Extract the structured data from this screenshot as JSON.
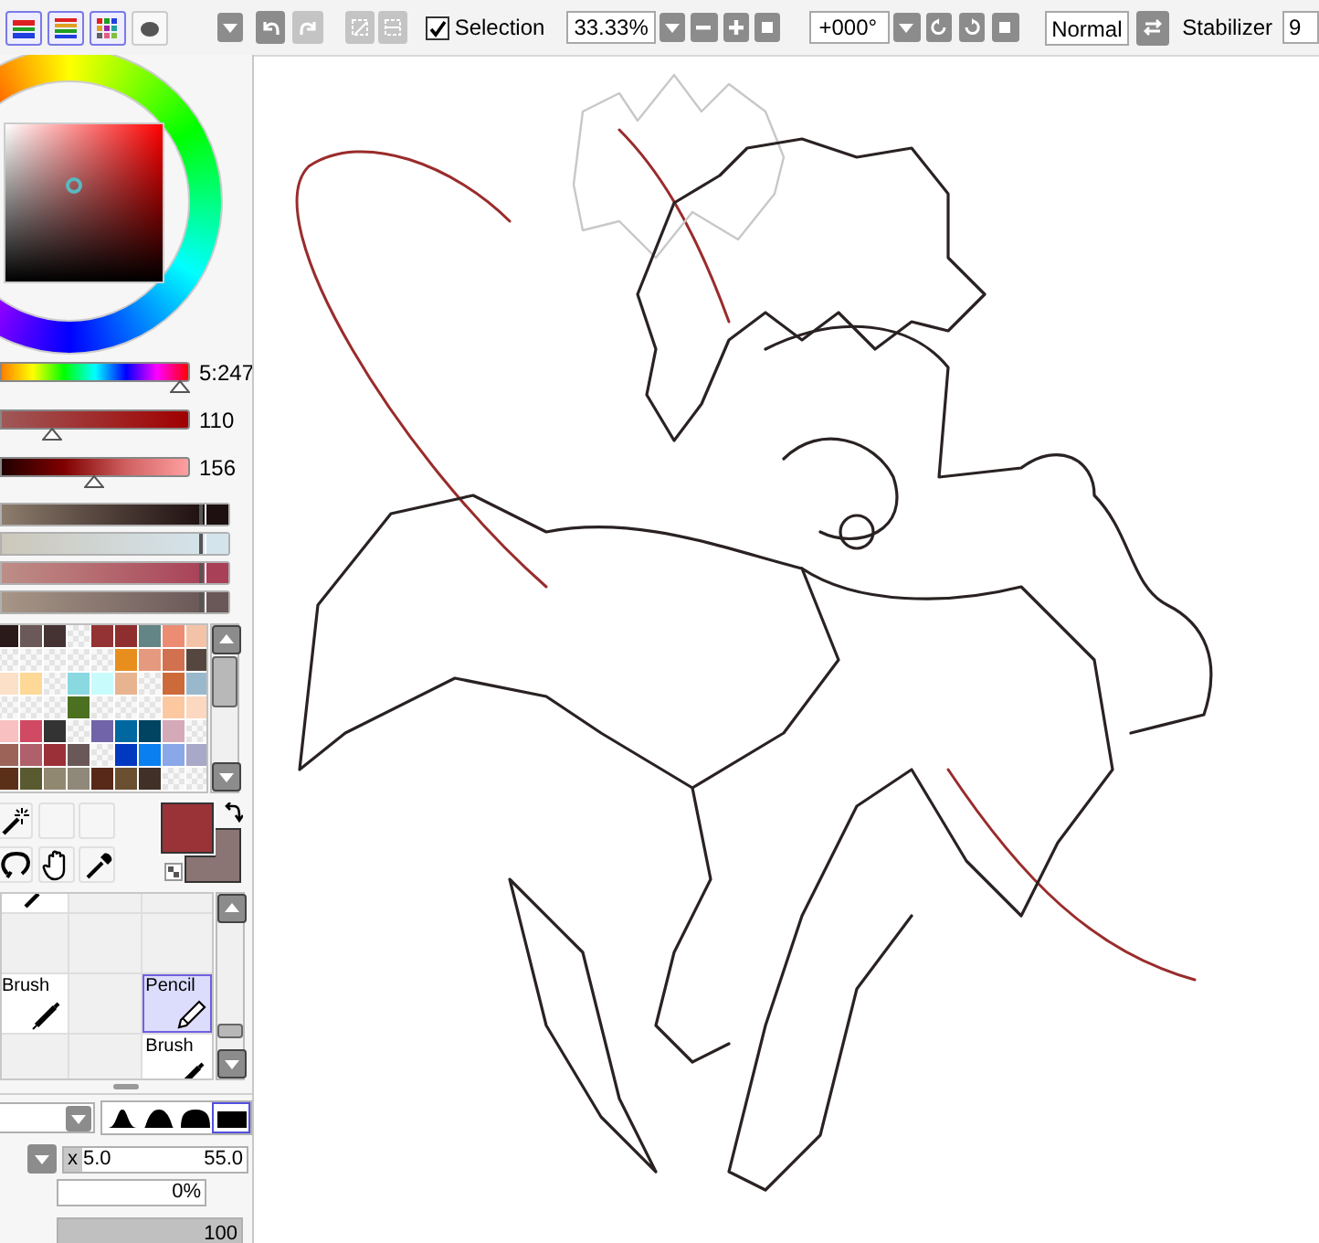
{
  "toolbar": {
    "panel_toggles": [
      {
        "kind": "wheel",
        "selected": true
      },
      {
        "kind": "sliders",
        "selected": true
      },
      {
        "kind": "swatches",
        "selected": true
      },
      {
        "kind": "scratchpad",
        "selected": false
      }
    ],
    "undo_enabled": true,
    "redo_enabled": false,
    "deselect_enabled": false,
    "invert_enabled": false,
    "selection": {
      "label": "Selection",
      "checked": true
    },
    "zoom": "33.33%",
    "rotation": "+000°",
    "blend_mode": "Normal",
    "stabilizer": {
      "label": "Stabilizer",
      "value": "9"
    }
  },
  "color_sliders": [
    {
      "kind": "hue",
      "level": 0.97,
      "reading": "5:247"
    },
    {
      "kind": "saturation",
      "level": 0.27,
      "reading": "110"
    },
    {
      "kind": "value",
      "level": 0.5,
      "reading": "156"
    }
  ],
  "gradient_sliders": [
    {
      "color": "#1e1010",
      "level": 0.98
    },
    {
      "color": "#d4e4ec",
      "level": 0.98
    },
    {
      "color": "#a84058",
      "level": 0.98
    },
    {
      "color": "#6a5858",
      "level": 0.98
    }
  ],
  "swatches": [
    {
      "cells": [
        {
          "color": "#2b1a1a"
        },
        {
          "color": "#6b5858"
        },
        {
          "color": "#453333"
        },
        {
          "kind": "empty"
        },
        {
          "color": "#933333"
        },
        {
          "color": "#8f2e2e"
        },
        {
          "color": "#648585"
        },
        {
          "color": "#ec8c73"
        },
        {
          "color": "#f3c3a8"
        }
      ]
    },
    {
      "cells": [
        {
          "kind": "empty"
        },
        {
          "kind": "empty"
        },
        {
          "kind": "empty"
        },
        {
          "kind": "empty"
        },
        {
          "kind": "empty"
        },
        {
          "color": "#e88e1e"
        },
        {
          "color": "#e59a80"
        },
        {
          "color": "#d1714f"
        },
        {
          "color": "#554740"
        }
      ]
    },
    {
      "cells": [
        {
          "color": "#fde0c8"
        },
        {
          "color": "#fdd896"
        },
        {
          "kind": "empty"
        },
        {
          "color": "#8ad8e0"
        },
        {
          "color": "#c8fcfc"
        },
        {
          "color": "#e8b490"
        },
        {
          "kind": "empty"
        },
        {
          "color": "#cc6a3a"
        },
        {
          "color": "#9ab8cc"
        }
      ]
    },
    {
      "cells": [
        {
          "kind": "empty"
        },
        {
          "kind": "empty"
        },
        {
          "kind": "empty"
        },
        {
          "color": "#4a7020"
        },
        {
          "kind": "empty"
        },
        {
          "kind": "empty"
        },
        {
          "kind": "empty"
        },
        {
          "color": "#fcc8a0"
        },
        {
          "color": "#fcd8c0"
        }
      ]
    },
    {
      "cells": [
        {
          "color": "#f8c0c0"
        },
        {
          "color": "#cf4a62"
        },
        {
          "color": "#333333"
        },
        {
          "kind": "empty"
        },
        {
          "color": "#7264a8"
        },
        {
          "color": "#0068a0"
        },
        {
          "color": "#004462"
        },
        {
          "color": "#d4aab8"
        },
        {
          "kind": "empty"
        }
      ]
    },
    {
      "cells": [
        {
          "color": "#9c6458"
        },
        {
          "color": "#b0606a"
        },
        {
          "color": "#9c3038"
        },
        {
          "color": "#6a5858"
        },
        {
          "kind": "empty"
        },
        {
          "color": "#0038c0"
        },
        {
          "color": "#0a80f0"
        },
        {
          "color": "#8aa8e8"
        },
        {
          "color": "#a8a8c8"
        }
      ]
    },
    {
      "cells": [
        {
          "color": "#5a3018"
        },
        {
          "color": "#5a5a30"
        },
        {
          "color": "#908870"
        },
        {
          "color": "#908878"
        },
        {
          "color": "#582818"
        },
        {
          "color": "#6a5030"
        },
        {
          "color": "#403028"
        },
        {
          "kind": "empty"
        },
        {
          "kind": "empty"
        }
      ]
    }
  ],
  "tools": [
    {
      "kind": "wand"
    },
    {
      "kind": "empty"
    },
    {
      "kind": "empty"
    },
    {
      "kind": "lasso"
    },
    {
      "kind": "hand"
    },
    {
      "kind": "eyedropper"
    }
  ],
  "primary": {
    "color": "#9a3337"
  },
  "secondary": {
    "color": "#8a7474"
  },
  "brush_slots": [
    {
      "kind": "pen",
      "selected": false
    },
    {
      "kind": "empty",
      "selected": false
    },
    {
      "kind": "empty",
      "selected": false
    },
    {
      "kind": "empty",
      "selected": false
    },
    {
      "kind": "empty",
      "selected": false
    },
    {
      "kind": "empty",
      "selected": false
    },
    {
      "kind": "brush",
      "label": "Brush",
      "selected": false
    },
    {
      "kind": "empty",
      "selected": false
    },
    {
      "kind": "pencil",
      "label": "Pencil",
      "selected": true
    },
    {
      "kind": "empty",
      "selected": false
    },
    {
      "kind": "empty",
      "selected": false
    },
    {
      "kind": "brush",
      "label": "Brush",
      "selected": false
    }
  ],
  "brush_shapes": [
    {
      "kind": "sharp",
      "selected": false
    },
    {
      "kind": "round",
      "selected": false
    },
    {
      "kind": "flat",
      "selected": false
    },
    {
      "kind": "solid",
      "selected": true
    }
  ],
  "brush_size": {
    "prefix": "x",
    "multiplier": "5.0",
    "size": "55.0"
  },
  "min_size": "0%",
  "density": {
    "level": 1,
    "reading": "100"
  }
}
